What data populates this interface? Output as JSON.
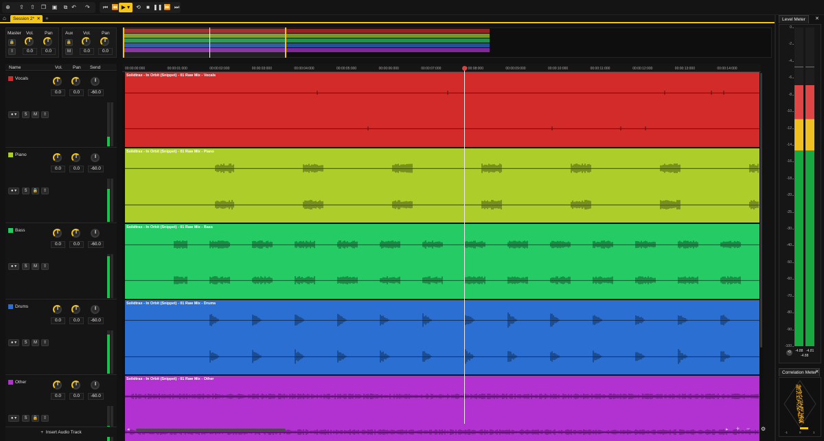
{
  "toolbar": {
    "buttons": [
      {
        "name": "add-icon",
        "glyph": "⊕"
      },
      {
        "name": "upload-icon",
        "glyph": "⇪"
      },
      {
        "name": "export-icon",
        "glyph": "⇧"
      },
      {
        "name": "copy-icon",
        "glyph": "❐"
      },
      {
        "name": "paste-icon",
        "glyph": "▣"
      },
      {
        "name": "duplicate-icon",
        "glyph": "⧉"
      }
    ],
    "undo_glyph": "↶",
    "redo_glyph": "↷",
    "transport": [
      {
        "name": "skip-start-icon",
        "glyph": "⏮"
      },
      {
        "name": "rewind-icon",
        "glyph": "⏪"
      },
      {
        "name": "play-icon",
        "glyph": "▶ ▾"
      },
      {
        "name": "loop-icon",
        "glyph": "⟲"
      },
      {
        "name": "stop-icon",
        "glyph": "■"
      },
      {
        "name": "pause-icon",
        "glyph": "❚❚"
      },
      {
        "name": "fast-forward-icon",
        "glyph": "⏩"
      },
      {
        "name": "skip-end-icon",
        "glyph": "⏭"
      }
    ]
  },
  "tabs": {
    "home_glyph": "⌂",
    "session_label": "Session 2*",
    "close_glyph": "✕",
    "new_glyph": "●"
  },
  "master": {
    "label": "Master",
    "vol_label": "Vol.",
    "pan_label": "Pan",
    "vol": "0.0",
    "pan": "0.0"
  },
  "aux": {
    "label": "Aux",
    "vol_label": "Vol.",
    "pan_label": "Pan",
    "vol": "0.0",
    "pan": "0.0",
    "m_label": "M"
  },
  "columns": {
    "name": "Name",
    "vol": "Vol.",
    "pan": "Pan",
    "send": "Send"
  },
  "tracks": [
    {
      "name": "Vocals",
      "color": "#d32a2a",
      "vol": "0.0",
      "pan": "0.0",
      "send": "-60.0",
      "s": "S",
      "m": "M",
      "clip": "Solidtrax - In Orbit (Snippet) - 01 Raw Mix - Vocals",
      "meter": 0.22
    },
    {
      "name": "Piano",
      "color": "#adce2a",
      "vol": "0.0",
      "pan": "0.0",
      "send": "-60.0",
      "s": "S",
      "m": "",
      "clip": "Solidtrax - In Orbit (Snippet) - 01 Raw Mix - Piano",
      "meter": 0.75
    },
    {
      "name": "Bass",
      "color": "#25cc65",
      "vol": "0.0",
      "pan": "0.0",
      "send": "-60.0",
      "s": "S",
      "m": "M",
      "clip": "Solidtrax - In Orbit (Snippet) - 01 Raw Mix - Bass",
      "meter": 0.95
    },
    {
      "name": "Drums",
      "color": "#2a6fd1",
      "vol": "0.0",
      "pan": "0.0",
      "send": "-60.0",
      "s": "S",
      "m": "M",
      "clip": "Solidtrax - In Orbit (Snippet) - 01 Raw Mix - Drums",
      "meter": 0.9
    },
    {
      "name": "Other",
      "color": "#b232d1",
      "vol": "0.0",
      "pan": "0.0",
      "send": "-60.0",
      "s": "S",
      "m": "",
      "clip": "Solidtrax - In Orbit (Snippet) - 01 Raw Mix - Other",
      "meter": 0.55
    }
  ],
  "insert_track": {
    "plus": "+",
    "label": "Insert Audio Track"
  },
  "ruler": [
    "00:00:00:000",
    "00:00:01:000",
    "00:00:02:000",
    "00:00:03:000",
    "00:00:04:000",
    "00:00:05:000",
    "00:00:06:000",
    "00:00:07:000",
    "00:00:08:000",
    "00:00:09:000",
    "00:00:10:000",
    "00:00:11:000",
    "00:00:12:000",
    "00:00:13:000",
    "00:00:14:000"
  ],
  "playhead_fraction": 0.535,
  "bottom_controls": {
    "plus": "+",
    "minus": "−",
    "gear": "⚙",
    "left": "◂",
    "right": "▸"
  },
  "level_meter": {
    "title": "Level Meter",
    "close": "✕",
    "scale": [
      "0",
      "-2",
      "-4",
      "-6",
      "-8",
      "-10",
      "-12",
      "-14",
      "-16",
      "-18",
      "-20",
      "-25",
      "-30",
      "-40",
      "-50",
      "-60",
      "-70",
      "-80",
      "-90",
      "-100"
    ],
    "left_value": "-4.88",
    "right_value": "-4.81",
    "combined": "-4.88",
    "left_level": 0.82,
    "right_level": 0.82
  },
  "correlation_meter": {
    "title": "Correlation Meter",
    "close": "✕",
    "minus": "-1",
    "zero": "0",
    "plus": "1"
  },
  "colors": {
    "accent": "#f5c518"
  }
}
